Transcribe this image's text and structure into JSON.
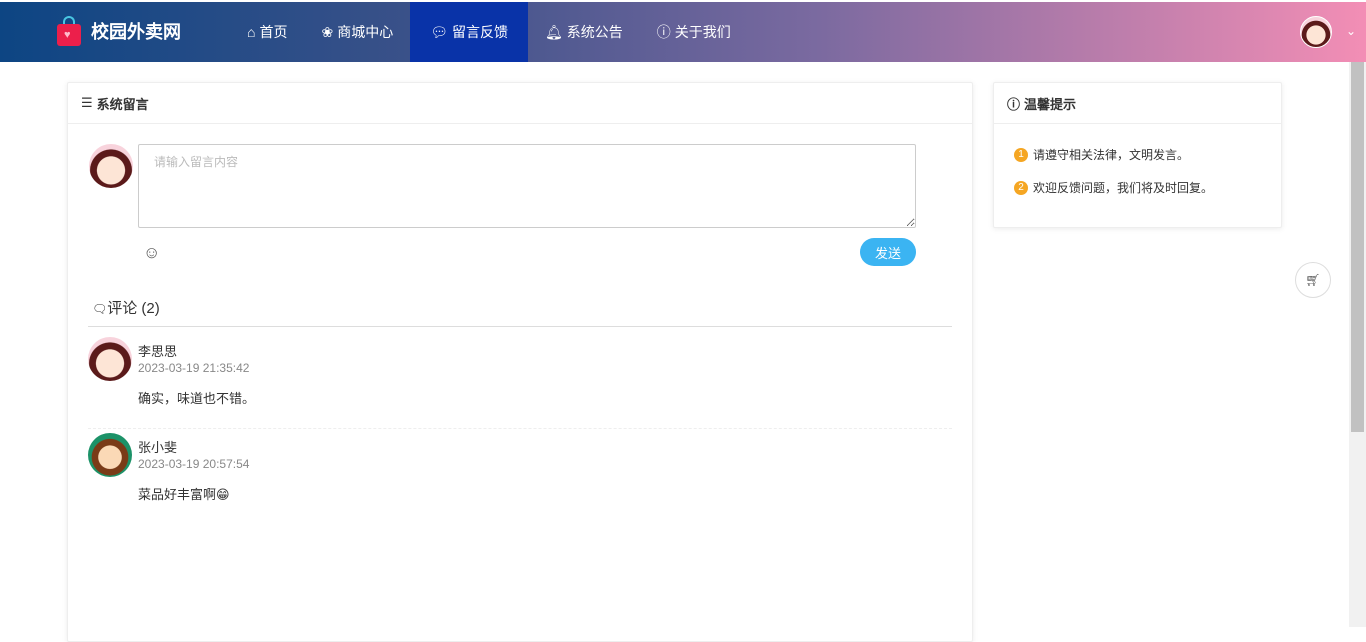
{
  "nav": {
    "brand": "校园外卖网",
    "items": [
      {
        "icon": "home-icon",
        "label": "首页"
      },
      {
        "icon": "paw-icon",
        "label": "商城中心"
      },
      {
        "icon": "comment-icon",
        "label": "留言反馈",
        "active": true
      },
      {
        "icon": "bell-icon",
        "label": "系统公告"
      },
      {
        "icon": "info-icon",
        "label": "关于我们"
      }
    ]
  },
  "main": {
    "title": "系统留言",
    "placeholder": "请输入留言内容",
    "send_label": "发送",
    "comments_label": "评论 (2)",
    "comments": [
      {
        "name": "李思思",
        "time": "2023-03-19 21:35:42",
        "text": "确实，味道也不错。"
      },
      {
        "name": "张小斐",
        "time": "2023-03-19 20:57:54",
        "text": "菜品好丰富啊😁"
      }
    ]
  },
  "tips": {
    "title": "温馨提示",
    "items": [
      "请遵守相关法律，文明发言。",
      "欢迎反馈问题，我们将及时回复。"
    ],
    "nums": [
      "1",
      "2"
    ]
  }
}
